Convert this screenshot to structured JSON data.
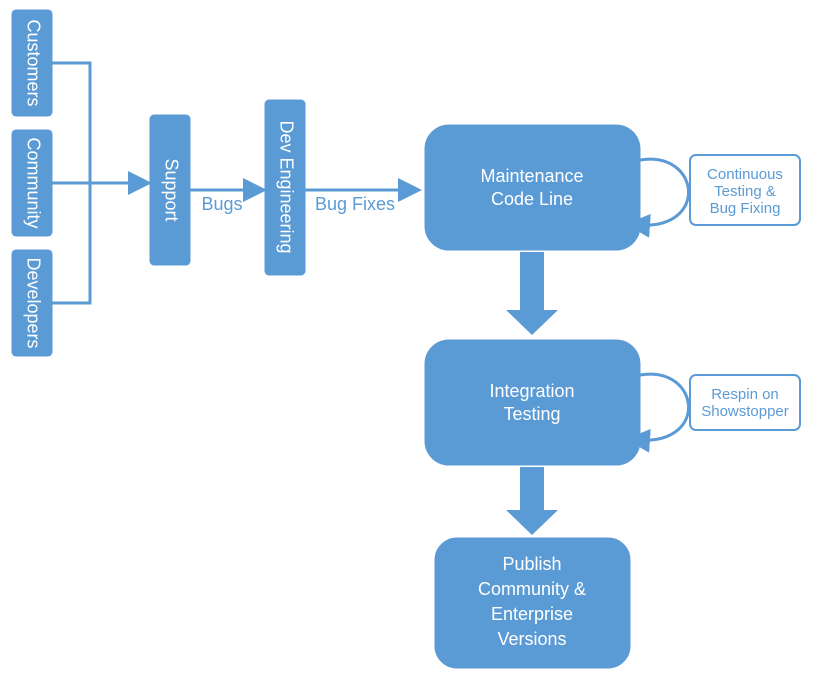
{
  "sources": {
    "customers": "Customers",
    "community": "Community",
    "developers": "Developers"
  },
  "support": "Support",
  "lbl_bugs": "Bugs",
  "dev_eng": "Dev Engineering",
  "lbl_bugfixes": "Bug Fixes",
  "maint": {
    "l1": "Maintenance",
    "l2": "Code Line"
  },
  "ann_maint": {
    "l1": "Continuous",
    "l2": "Testing &",
    "l3": "Bug Fixing"
  },
  "integ": {
    "l1": "Integration",
    "l2": "Testing"
  },
  "ann_integ": {
    "l1": "Respin on",
    "l2": "Showstopper"
  },
  "publish": {
    "l1": "Publish",
    "l2": "Community &",
    "l3": "Enterprise",
    "l4": "Versions"
  }
}
